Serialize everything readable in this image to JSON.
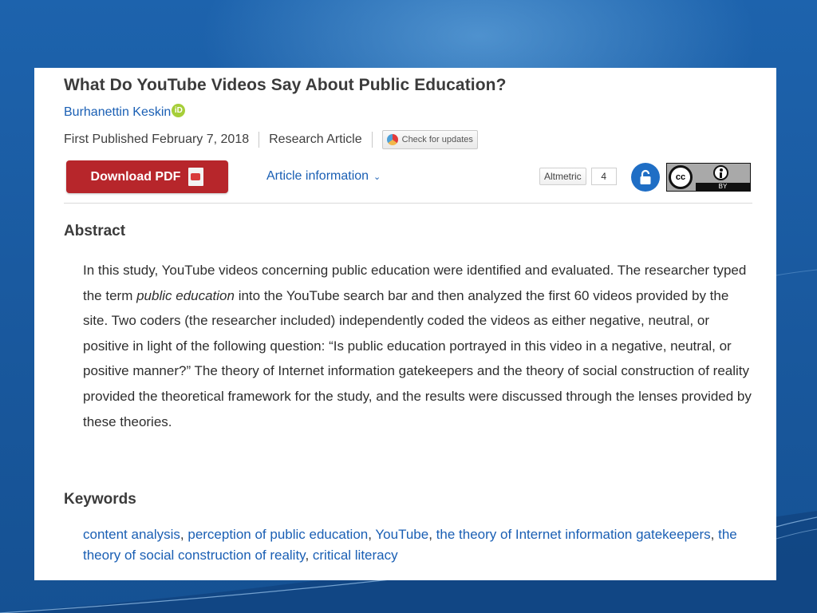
{
  "article": {
    "title": "What Do YouTube Videos Say About Public Education?",
    "author": "Burhanettin Keskin",
    "orcid_mark": "iD",
    "published": "First Published February 7, 2018",
    "type": "Research Article",
    "check_updates": "Check for updates"
  },
  "actions": {
    "download": "Download PDF",
    "article_info": "Article information",
    "altmetric_label": "Altmetric",
    "altmetric_count": "4",
    "license_cc": "cc",
    "license_by": "BY"
  },
  "abstract": {
    "heading": "Abstract",
    "before_em": "In this study, YouTube videos concerning public education were identified and evaluated. The researcher typed the term ",
    "em": "public education",
    "after_em": " into the YouTube search bar and then analyzed the first 60 videos provided by the site. Two coders (the researcher included) independently coded the videos as either negative, neutral, or positive in light of the following question: “Is public education portrayed in this video in a negative, neutral, or positive manner?” The theory of Internet information gatekeepers and the theory of social construction of reality provided the theoretical framework for the study, and the results were discussed through the lenses provided by these theories."
  },
  "keywords": {
    "heading": "Keywords",
    "items": [
      "content analysis",
      "perception of public education",
      "YouTube",
      "the theory of Internet information gatekeepers",
      "the theory of social construction of reality",
      "critical literacy"
    ],
    "separator": ", "
  },
  "colors": {
    "background": "#1a5aa0",
    "link": "#1a5fb4",
    "download_button": "#b7262b",
    "open_access": "#1f6ec5",
    "orcid": "#a6ce39"
  }
}
